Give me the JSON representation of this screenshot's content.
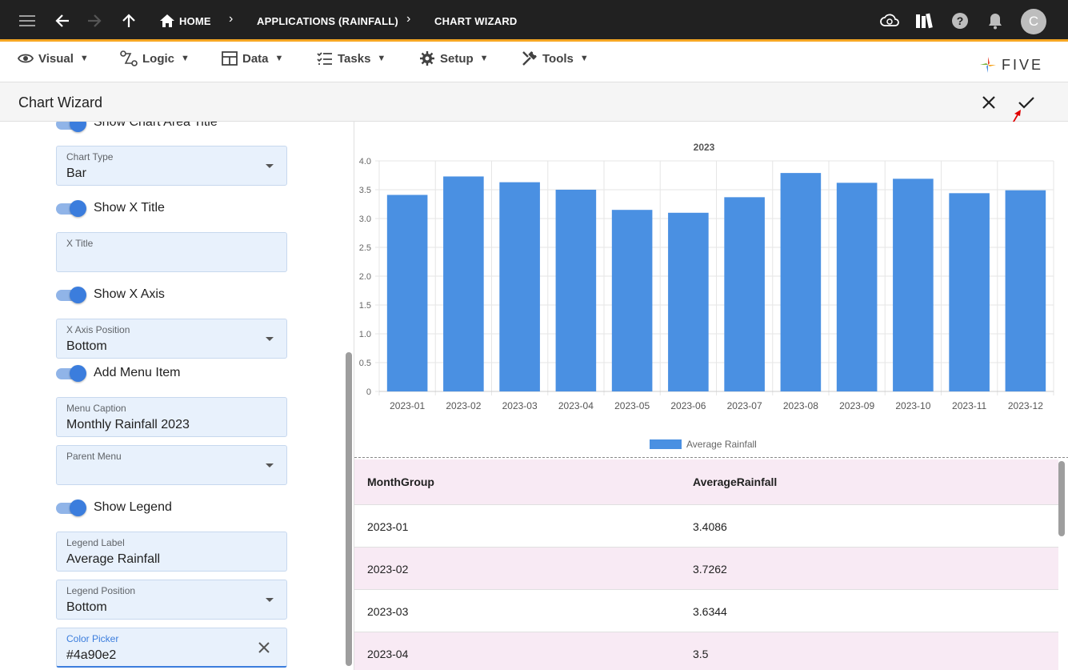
{
  "topbar": {
    "crumbs": {
      "home": "HOME",
      "applications": "APPLICATIONS (RAINFALL)",
      "chart_wizard": "CHART WIZARD"
    },
    "avatar_letter": "C"
  },
  "menubar": {
    "visual": "Visual",
    "logic": "Logic",
    "data": "Data",
    "tasks": "Tasks",
    "setup": "Setup",
    "tools": "Tools",
    "logo_text": "FIVE"
  },
  "header": {
    "title": "Chart Wizard"
  },
  "form": {
    "show_chart_area_title": "Show Chart Area Title",
    "chart_type": {
      "label": "Chart Type",
      "value": "Bar"
    },
    "show_x_title": "Show X Title",
    "x_title": {
      "label": "X Title",
      "value": ""
    },
    "show_x_axis": "Show X Axis",
    "x_axis_position": {
      "label": "X Axis Position",
      "value": "Bottom"
    },
    "add_menu_item": "Add Menu Item",
    "menu_caption": {
      "label": "Menu Caption",
      "value": "Monthly Rainfall 2023"
    },
    "parent_menu": {
      "label": "Parent Menu",
      "value": ""
    },
    "show_legend": "Show Legend",
    "legend_label": {
      "label": "Legend Label",
      "value": "Average Rainfall"
    },
    "legend_position": {
      "label": "Legend Position",
      "value": "Bottom"
    },
    "color_picker": {
      "label": "Color Picker",
      "value": "#4a90e2"
    }
  },
  "table": {
    "headers": [
      "MonthGroup",
      "AverageRainfall"
    ],
    "rows": [
      [
        "2023-01",
        "3.4086"
      ],
      [
        "2023-02",
        "3.7262"
      ],
      [
        "2023-03",
        "3.6344"
      ],
      [
        "2023-04",
        "3.5"
      ]
    ]
  },
  "colors": {
    "bar": "#4a90e2",
    "topbar": "#212121",
    "accent_line": "#f5a623"
  },
  "chart_data": {
    "type": "bar",
    "title": "2023",
    "categories": [
      "2023-01",
      "2023-02",
      "2023-03",
      "2023-04",
      "2023-05",
      "2023-06",
      "2023-07",
      "2023-08",
      "2023-09",
      "2023-10",
      "2023-11",
      "2023-12"
    ],
    "series": [
      {
        "name": "Average Rainfall",
        "values": [
          3.41,
          3.73,
          3.63,
          3.5,
          3.15,
          3.1,
          3.37,
          3.79,
          3.62,
          3.69,
          3.44,
          3.49
        ]
      }
    ],
    "yticks": [
      "0",
      "0.5",
      "1.0",
      "1.5",
      "2.0",
      "2.5",
      "3.0",
      "3.5",
      "4.0"
    ],
    "ylim": [
      0,
      4
    ],
    "legend_position": "bottom",
    "grid": true
  }
}
